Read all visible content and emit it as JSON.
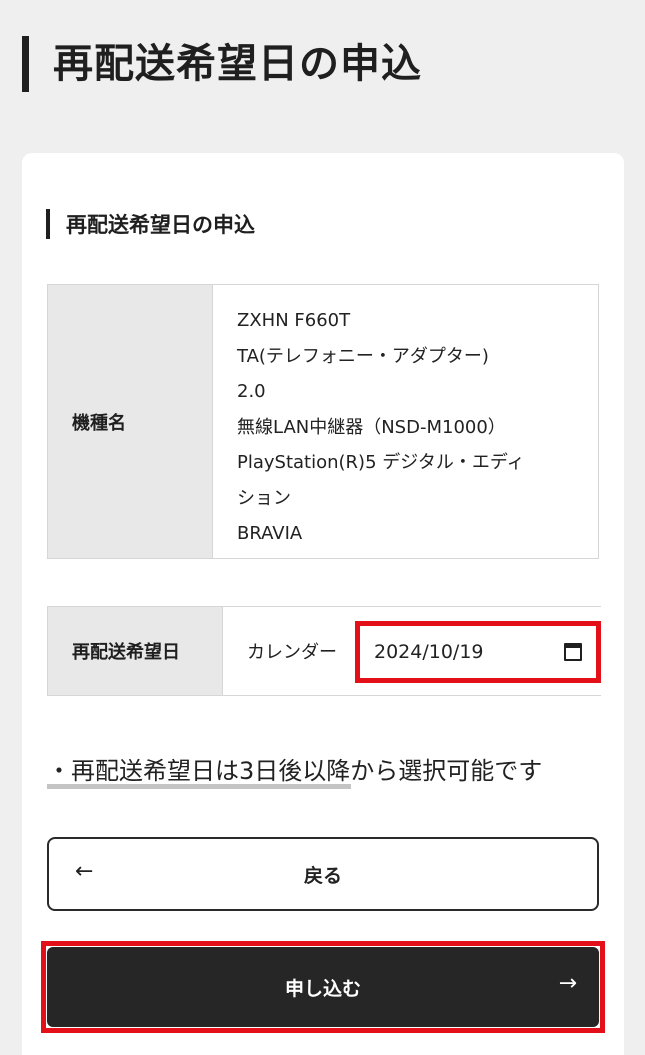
{
  "page": {
    "title": "再配送希望日の申込"
  },
  "section": {
    "title": "再配送希望日の申込"
  },
  "model_table": {
    "header": "機種名",
    "lines": [
      "ZXHN F660T",
      "TA(テレフォニー・アダプター)",
      "2.0",
      "無線LAN中継器（NSD-M1000）",
      "PlayStation(R)5 デジタル・エディ",
      "ション",
      "BRAVIA"
    ]
  },
  "date_table": {
    "header": "再配送希望日",
    "calendar_label": "カレンダー",
    "date_value": "2024/10/19",
    "date_icon": "calendar-icon"
  },
  "note": "・再配送希望日は3日後以降から選択可能です",
  "buttons": {
    "back_label": "戻る",
    "back_icon": "arrow-left-icon",
    "back_glyph": "←",
    "submit_label": "申し込む",
    "submit_icon": "arrow-right-icon",
    "submit_glyph": "→"
  },
  "colors": {
    "highlight": "#e3101a",
    "primary_button": "#262626",
    "background": "#efefef"
  }
}
